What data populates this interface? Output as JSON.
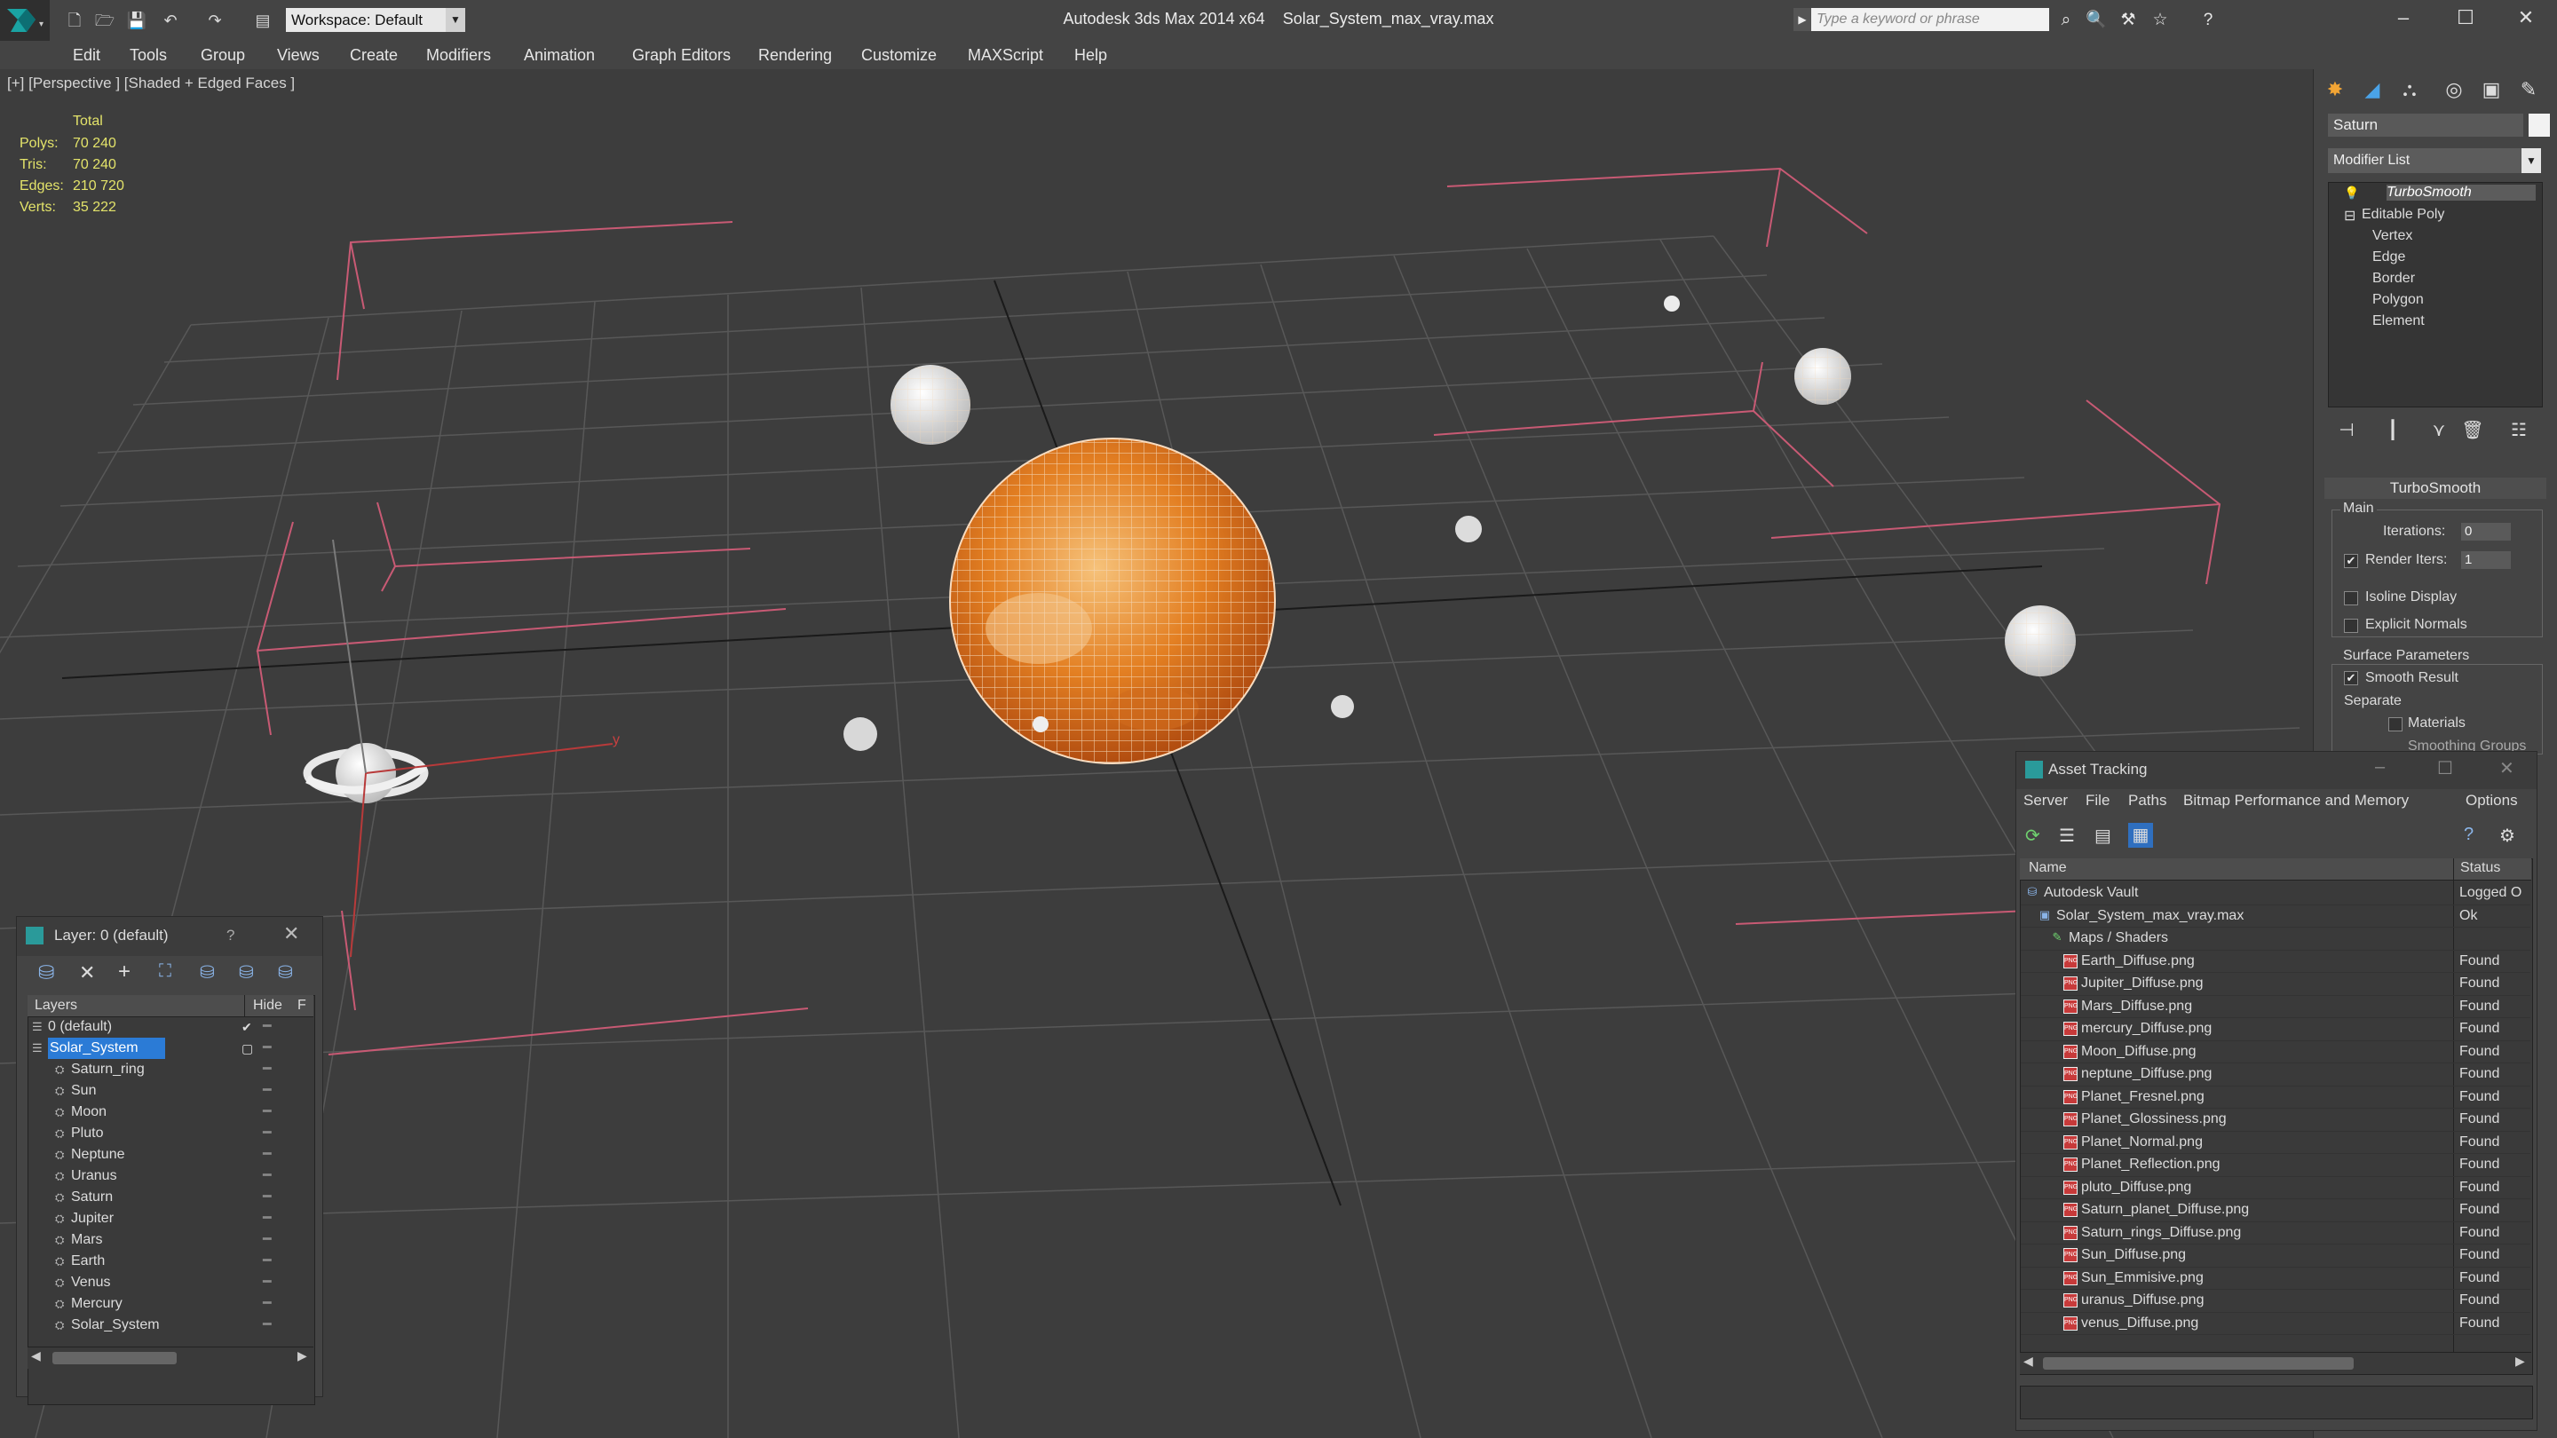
{
  "app": {
    "title": "Autodesk 3ds Max 2014 x64",
    "file": "Solar_System_max_vray.max",
    "workspace": "Workspace: Default",
    "search_placeholder": "Type a keyword or phrase"
  },
  "menu": [
    "Edit",
    "Tools",
    "Group",
    "Views",
    "Create",
    "Modifiers",
    "Animation",
    "Graph Editors",
    "Rendering",
    "Customize",
    "MAXScript",
    "Help"
  ],
  "viewport": {
    "label": "[+] [Perspective ] [Shaded + Edged Faces ]",
    "stats": {
      "header": "Total",
      "rows": [
        {
          "label": "Polys:",
          "value": "70 240"
        },
        {
          "label": "Tris:",
          "value": "70 240"
        },
        {
          "label": "Edges:",
          "value": "210 720"
        },
        {
          "label": "Verts:",
          "value": "35 222"
        }
      ]
    },
    "axis_y_label": "y"
  },
  "command_panel": {
    "object_name": "Saturn",
    "modifier_list": "Modifier List",
    "stack": {
      "top": "TurboSmooth",
      "base": "Editable Poly",
      "subobjects": [
        "Vertex",
        "Edge",
        "Border",
        "Polygon",
        "Element"
      ]
    },
    "rollout": {
      "title": "TurboSmooth",
      "main_label": "Main",
      "iterations_label": "Iterations:",
      "iterations_value": "0",
      "render_iters_label": "Render Iters:",
      "render_iters_value": "1",
      "isoline_label": "Isoline Display",
      "explicit_normals_label": "Explicit Normals",
      "surface_params_label": "Surface Parameters",
      "smooth_result_label": "Smooth Result",
      "separate_label": "Separate",
      "materials_label": "Materials",
      "smoothing_groups_label": "Smoothing Groups"
    }
  },
  "layer_dialog": {
    "title": "Layer: 0 (default)",
    "help": "?",
    "col_layers": "Layers",
    "col_hide": "Hide",
    "col_f": "F",
    "layers": [
      {
        "name": "0 (default)",
        "level": 0,
        "selected": false,
        "check": "✔"
      },
      {
        "name": "Solar_System",
        "level": 0,
        "selected": true,
        "check": ""
      },
      {
        "name": "Saturn_ring",
        "level": 1
      },
      {
        "name": "Sun",
        "level": 1
      },
      {
        "name": "Moon",
        "level": 1
      },
      {
        "name": "Pluto",
        "level": 1
      },
      {
        "name": "Neptune",
        "level": 1
      },
      {
        "name": "Uranus",
        "level": 1
      },
      {
        "name": "Saturn",
        "level": 1
      },
      {
        "name": "Jupiter",
        "level": 1
      },
      {
        "name": "Mars",
        "level": 1
      },
      {
        "name": "Earth",
        "level": 1
      },
      {
        "name": "Venus",
        "level": 1
      },
      {
        "name": "Mercury",
        "level": 1
      },
      {
        "name": "Solar_System",
        "level": 1
      }
    ]
  },
  "asset_tracking": {
    "title": "Asset Tracking",
    "menu": [
      "Server",
      "File",
      "Paths",
      "Bitmap Performance and Memory",
      "Options"
    ],
    "col_name": "Name",
    "col_status": "Status",
    "rows": [
      {
        "name": "Autodesk Vault",
        "status": "Logged O",
        "level": 0,
        "icon": "vault"
      },
      {
        "name": "Solar_System_max_vray.max",
        "status": "Ok",
        "level": 1,
        "icon": "max"
      },
      {
        "name": "Maps / Shaders",
        "status": "",
        "level": 2,
        "icon": "maps"
      },
      {
        "name": "Earth_Diffuse.png",
        "status": "Found",
        "level": 3,
        "icon": "png"
      },
      {
        "name": "Jupiter_Diffuse.png",
        "status": "Found",
        "level": 3,
        "icon": "png"
      },
      {
        "name": "Mars_Diffuse.png",
        "status": "Found",
        "level": 3,
        "icon": "png"
      },
      {
        "name": "mercury_Diffuse.png",
        "status": "Found",
        "level": 3,
        "icon": "png"
      },
      {
        "name": "Moon_Diffuse.png",
        "status": "Found",
        "level": 3,
        "icon": "png"
      },
      {
        "name": "neptune_Diffuse.png",
        "status": "Found",
        "level": 3,
        "icon": "png"
      },
      {
        "name": "Planet_Fresnel.png",
        "status": "Found",
        "level": 3,
        "icon": "png"
      },
      {
        "name": "Planet_Glossiness.png",
        "status": "Found",
        "level": 3,
        "icon": "png"
      },
      {
        "name": "Planet_Normal.png",
        "status": "Found",
        "level": 3,
        "icon": "png"
      },
      {
        "name": "Planet_Reflection.png",
        "status": "Found",
        "level": 3,
        "icon": "png"
      },
      {
        "name": "pluto_Diffuse.png",
        "status": "Found",
        "level": 3,
        "icon": "png"
      },
      {
        "name": "Saturn_planet_Diffuse.png",
        "status": "Found",
        "level": 3,
        "icon": "png"
      },
      {
        "name": "Saturn_rings_Diffuse.png",
        "status": "Found",
        "level": 3,
        "icon": "png"
      },
      {
        "name": "Sun_Diffuse.png",
        "status": "Found",
        "level": 3,
        "icon": "png"
      },
      {
        "name": "Sun_Emmisive.png",
        "status": "Found",
        "level": 3,
        "icon": "png"
      },
      {
        "name": "uranus_Diffuse.png",
        "status": "Found",
        "level": 3,
        "icon": "png"
      },
      {
        "name": "venus_Diffuse.png",
        "status": "Found",
        "level": 3,
        "icon": "png"
      }
    ]
  },
  "colors": {
    "grid": "#5a5a5a",
    "bounds": "#d0617a",
    "sun": "#e07a24",
    "stats": "#e3e36a",
    "selection": "#2b7bd6"
  }
}
